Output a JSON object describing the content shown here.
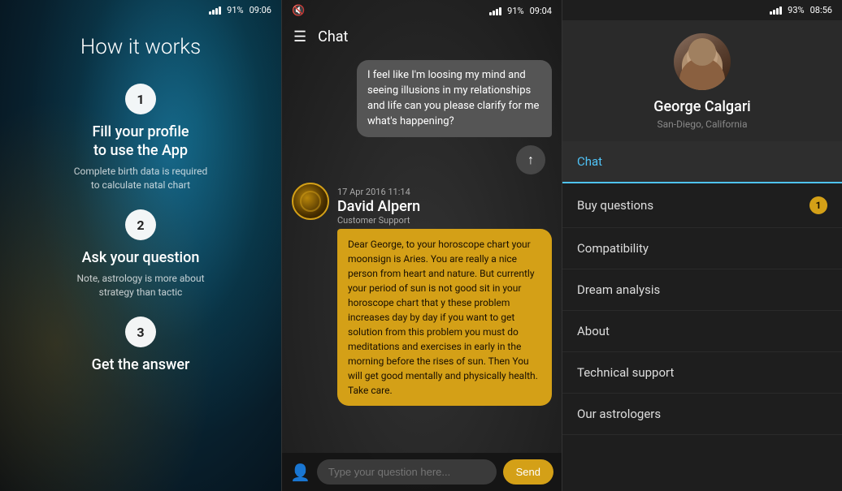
{
  "panel1": {
    "status": {
      "time": "09:06",
      "battery": "91%"
    },
    "title": "How it works",
    "steps": [
      {
        "number": "1",
        "heading": "Fill your profile\nto use the App",
        "sub": "Complete birth data is required\nto calculate natal chart"
      },
      {
        "number": "2",
        "heading": "Ask your question",
        "sub": "Note, astrology is more about\nstrategy than tactic"
      },
      {
        "number": "3",
        "heading": "Get the answer",
        "sub": ""
      }
    ]
  },
  "panel2": {
    "status": {
      "time": "09:04",
      "battery": "91%"
    },
    "header_title": "Chat",
    "messages": [
      {
        "type": "user",
        "text": "I feel like I'm loosing my mind and seeing illusions in my relationships and life can you please clarify for me what's happening?"
      },
      {
        "type": "agent",
        "date": "17 Apr 2016 11:14",
        "name": "David Alpern",
        "role": "Customer Support",
        "text": "Dear George, to your horoscope chart your moonsign is Aries. You are really a nice person from heart and nature. But currently your period of sun is not good sit in your horoscope chart that y these problem increases day by day if you want to get solution from this problem you must do meditations and exercises in early in the morning before the rises of sun. Then You will get good mentally and physically health. Take care."
      }
    ],
    "input_placeholder": "Type your question here...",
    "send_label": "Send"
  },
  "panel3": {
    "status": {
      "time": "08:56",
      "battery": "93%"
    },
    "profile": {
      "name": "George Calgari",
      "location": "San-Diego, California"
    },
    "nav_items": [
      {
        "label": "Chat",
        "active": true,
        "badge": null
      },
      {
        "label": "Buy questions",
        "active": false,
        "badge": "1"
      },
      {
        "label": "Compatibility",
        "active": false,
        "badge": null
      },
      {
        "label": "Dream analysis",
        "active": false,
        "badge": null
      },
      {
        "label": "About",
        "active": false,
        "badge": null
      },
      {
        "label": "Technical support",
        "active": false,
        "badge": null
      },
      {
        "label": "Our astrologers",
        "active": false,
        "badge": null
      }
    ]
  }
}
